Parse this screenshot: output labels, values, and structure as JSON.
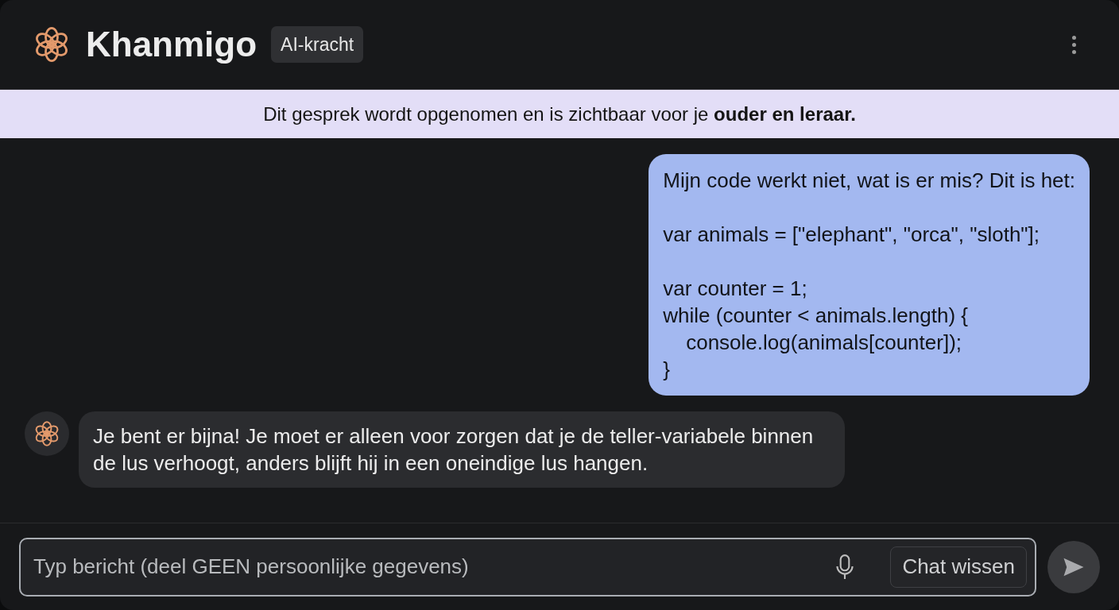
{
  "header": {
    "title": "Khanmigo",
    "badge": "AI-kracht"
  },
  "banner": {
    "text": "Dit gesprek wordt opgenomen en is zichtbaar voor je **ouder en leraar.**"
  },
  "messages": [
    {
      "kind": "user",
      "text": "Mijn code werkt niet, wat is er mis? Dit is het:\n\nvar animals = [\"elephant\", \"orca\", \"sloth\"];\n\nvar counter = 1;\nwhile (counter < animals.length) {\n    console.log(animals[counter]);\n}"
    },
    {
      "kind": "assistant",
      "text": "Je bent er bijna! Je moet er alleen voor zorgen dat je de teller-variabele binnen de lus verhoogt, anders blijft hij in een oneindige lus hangen."
    }
  ],
  "composer": {
    "placeholder": "Typ bericht (deel GEEN persoonlijke gegevens)",
    "clear_button": "Chat wissen"
  }
}
